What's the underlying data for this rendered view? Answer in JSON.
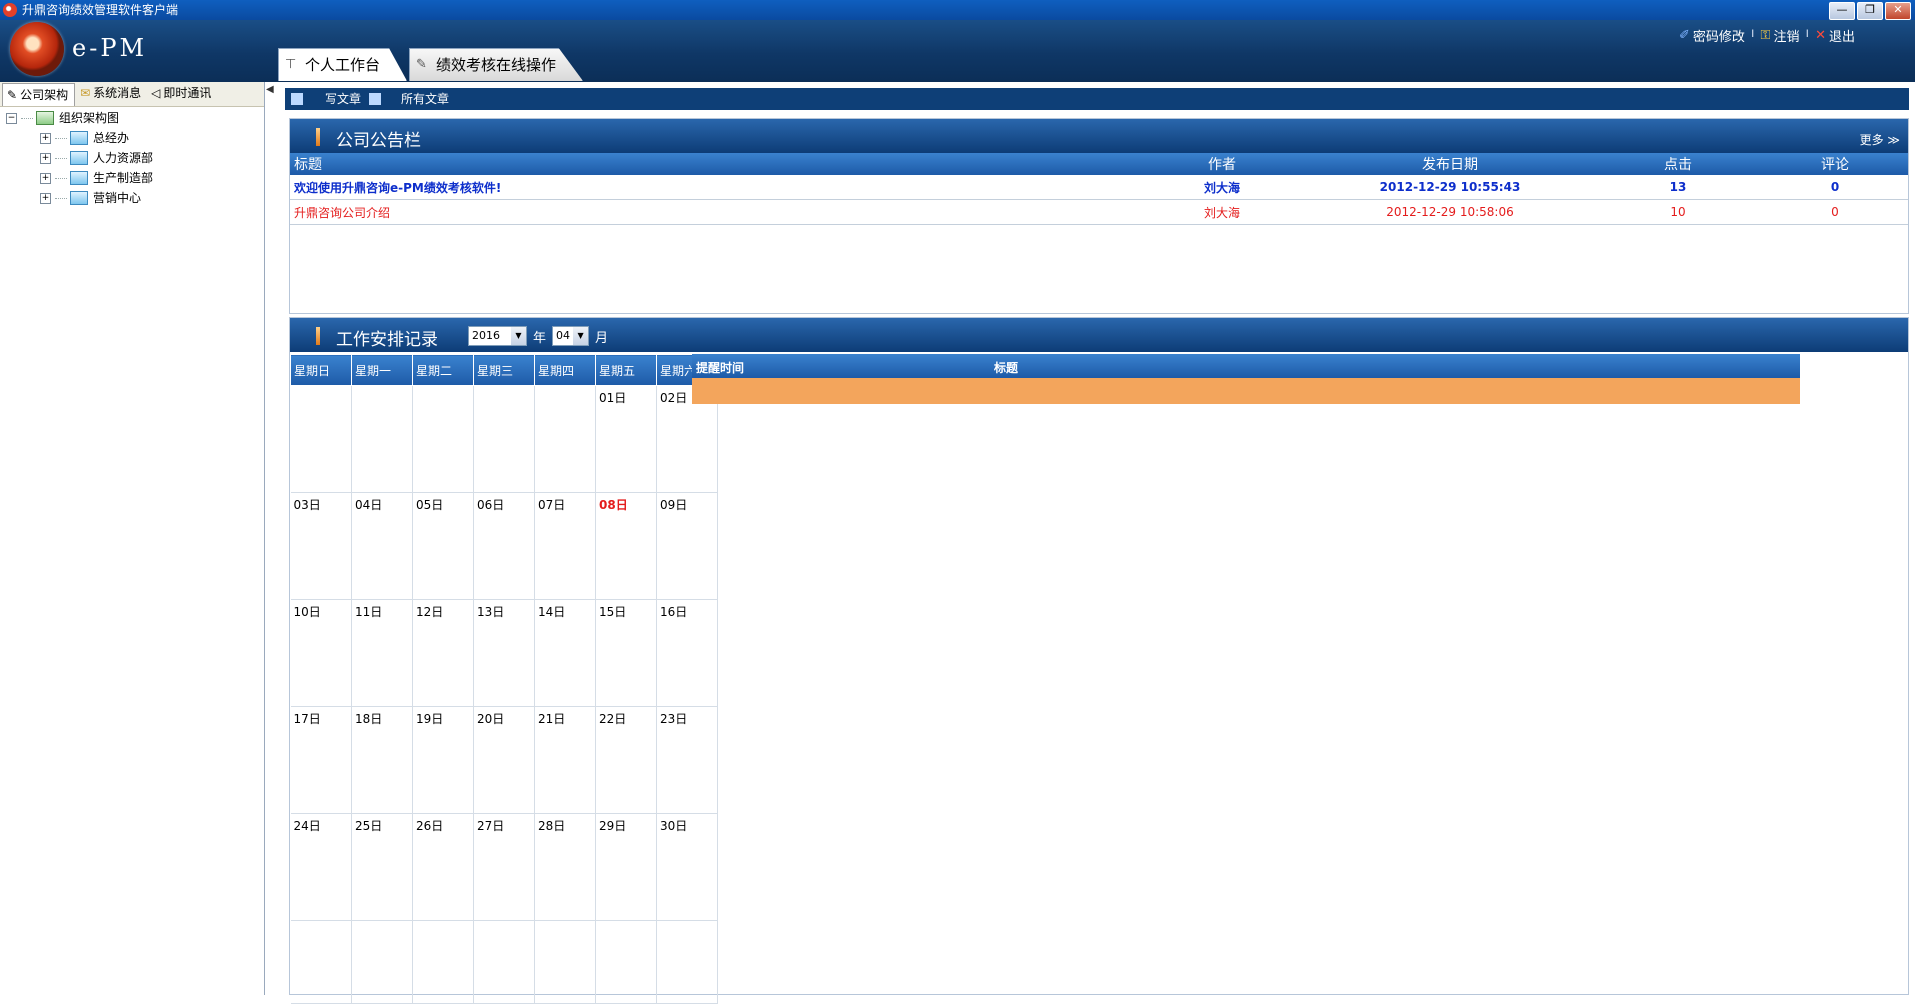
{
  "window": {
    "title": "升鼎咨询绩效管理软件客户端",
    "buttons": [
      "—",
      "❐",
      "✕"
    ]
  },
  "header": {
    "logo_text": "e-PM",
    "tabs": [
      {
        "label": "个人工作台",
        "icon": "pin-icon"
      },
      {
        "label": "绩效考核在线操作",
        "icon": "pencil-icon"
      }
    ],
    "links": {
      "password": "密码修改",
      "logout": "注销",
      "exit": "退出"
    }
  },
  "left_tabs": [
    "公司架构",
    "系统消息",
    "即时通讯"
  ],
  "tree": {
    "root": "组织架构图",
    "children": [
      "总经办",
      "人力资源部",
      "生产制造部",
      "营销中心"
    ]
  },
  "subbar": {
    "write": "写文章",
    "all": "所有文章"
  },
  "notice": {
    "title": "公司公告栏",
    "more": "更多 ≫",
    "columns": [
      "标题",
      "作者",
      "发布日期",
      "点击",
      "评论"
    ],
    "rows": [
      [
        "欢迎使用升鼎咨询e-PM绩效考核软件!",
        "刘大海",
        "2012-12-29 10:55:43",
        "13",
        "0"
      ],
      [
        "升鼎咨询公司介绍",
        "刘大海",
        "2012-12-29 10:58:06",
        "10",
        "0"
      ]
    ]
  },
  "work": {
    "title": "工作安排记录",
    "year": "2016",
    "year_label": "年",
    "month": "04",
    "month_label": "月",
    "weekdays": [
      "星期日",
      "星期一",
      "星期二",
      "星期三",
      "星期四",
      "星期五",
      "星期六"
    ],
    "weeks": [
      [
        "",
        "",
        "",
        "",
        "",
        "01日",
        "02日"
      ],
      [
        "03日",
        "04日",
        "05日",
        "06日",
        "07日",
        "08日",
        "09日"
      ],
      [
        "10日",
        "11日",
        "12日",
        "13日",
        "14日",
        "15日",
        "16日"
      ],
      [
        "17日",
        "18日",
        "19日",
        "20日",
        "21日",
        "22日",
        "23日"
      ],
      [
        "24日",
        "25日",
        "26日",
        "27日",
        "28日",
        "29日",
        "30日"
      ],
      [
        "",
        "",
        "",
        "",
        "",
        "",
        ""
      ]
    ],
    "today": "08日",
    "remind_columns": [
      "提醒时间",
      "标题"
    ]
  }
}
